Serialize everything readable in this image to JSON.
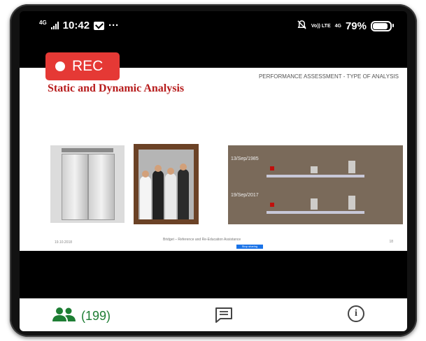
{
  "status_bar": {
    "network_type": "4G",
    "time": "10:42",
    "overflow": "···",
    "volte": "Vo)) LTE",
    "network_right": "4G",
    "battery": "79%",
    "battery_level": 0.79
  },
  "recording": {
    "label": "REC"
  },
  "slide": {
    "header": "PERFORMANCE ASSESSMENT - TYPE OF ANALYSIS",
    "title": "Static and Dynamic Analysis",
    "diagram_dates": [
      "13/Sep/1985",
      "19/Sep/2017"
    ],
    "footer_left": "19.10.2018",
    "footer_center": "Bridget – Reference and Re-Education Assistance",
    "footer_right": "18",
    "share_button": "Stop sharing"
  },
  "bottom_nav": {
    "participants_count": "(199)",
    "participants_icon": "people-icon",
    "chat_icon": "chat-icon",
    "info_icon": "info-icon"
  },
  "colors": {
    "rec_red": "#e53935",
    "participants_green": "#1e7e34",
    "title_red": "#b71c1c"
  }
}
